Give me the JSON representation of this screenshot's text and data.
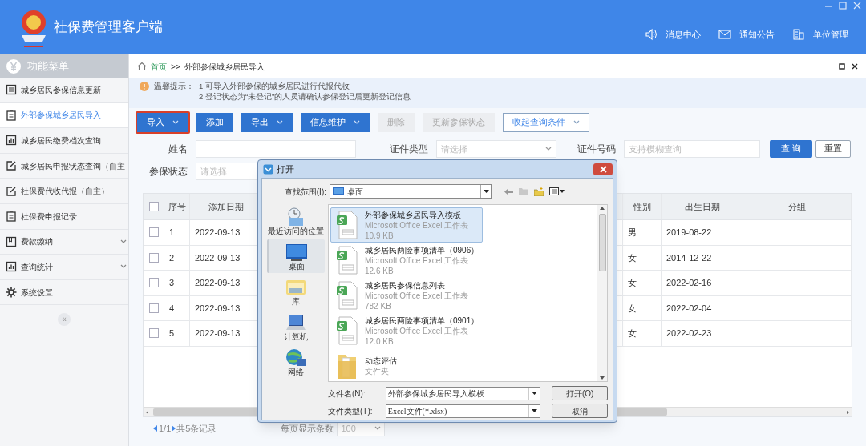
{
  "app": {
    "title": "社保费管理客户端",
    "nav": [
      {
        "label": "消息中心",
        "kind": "speaker"
      },
      {
        "label": "通知公告",
        "kind": "mail"
      },
      {
        "label": "单位管理",
        "kind": "building"
      }
    ]
  },
  "sidebar": {
    "title": "功能菜单",
    "collapse": "«",
    "items": [
      {
        "label": "城乡居民参保信息更新",
        "kind": "list",
        "selected": false,
        "expandable": false
      },
      {
        "label": "外部参保城乡居民导入",
        "kind": "clipboard",
        "selected": true,
        "expandable": false
      },
      {
        "label": "城乡居民缴费档次查询",
        "kind": "chart",
        "selected": false,
        "expandable": false
      },
      {
        "label": "城乡居民申报状态查询（自主",
        "kind": "edit",
        "selected": false,
        "expandable": false
      },
      {
        "label": "社保费代收代报（自主）",
        "kind": "edit",
        "selected": false,
        "expandable": false
      },
      {
        "label": "社保费申报记录",
        "kind": "clipboard",
        "selected": false,
        "expandable": false
      },
      {
        "label": "费款缴纳",
        "kind": "book",
        "selected": false,
        "expandable": true
      },
      {
        "label": "查询统计",
        "kind": "chart",
        "selected": false,
        "expandable": true
      },
      {
        "label": "系统设置",
        "kind": "gear",
        "selected": false,
        "expandable": false
      }
    ]
  },
  "breadcrumb": {
    "home": "首页",
    "separator": ">>",
    "current": "外部参保城乡居民导入"
  },
  "tip": {
    "label": "温馨提示：",
    "lines": [
      "1.可导入外部参保的城乡居民进行代报代收",
      "2.登记状态为“未登记”的人员请确认参保登记后更新登记信息"
    ]
  },
  "toolbar": [
    {
      "label": "导入",
      "kind": "primary",
      "dropdown": true,
      "highlighted": true
    },
    {
      "label": "添加",
      "kind": "primary",
      "dropdown": false,
      "highlighted": false
    },
    {
      "label": "导出",
      "kind": "primary",
      "dropdown": true,
      "highlighted": false
    },
    {
      "label": "信息维护",
      "kind": "primary",
      "dropdown": true,
      "highlighted": false
    },
    {
      "label": "删除",
      "kind": "disabled",
      "dropdown": false,
      "highlighted": false
    },
    {
      "label": "更新参保状态",
      "kind": "disabled",
      "dropdown": false,
      "highlighted": false
    },
    {
      "label": "收起查询条件",
      "kind": "outline",
      "dropdown": true,
      "highlighted": false
    }
  ],
  "filters": [
    {
      "label": "姓名",
      "dropdown": false
    },
    {
      "label": "证件类型",
      "placeholder": "请选择",
      "dropdown": true
    },
    {
      "label": "证件号码",
      "placeholder": "支持模糊查询",
      "dropdown": false
    },
    {
      "label": "参保状态",
      "placeholder": "请选择"
    }
  ],
  "search_buttons": [
    "查 询",
    "重置"
  ],
  "table": {
    "all_checked": false,
    "columns": [
      "序号",
      "添加日期",
      "性别",
      "出生日期",
      "分组"
    ],
    "rows": [
      {
        "checked": false,
        "cells": [
          "1",
          "2022-09-13",
          "男",
          "2019-08-22"
        ]
      },
      {
        "checked": false,
        "cells": [
          "2",
          "2022-09-13",
          "女",
          "2014-12-22"
        ]
      },
      {
        "checked": false,
        "cells": [
          "3",
          "2022-09-13",
          "女",
          "2022-02-16"
        ]
      },
      {
        "checked": false,
        "cells": [
          "4",
          "2022-09-13",
          "女",
          "2022-02-04"
        ]
      },
      {
        "checked": false,
        "cells": [
          "5",
          "2022-09-13",
          "女",
          "2022-02-23"
        ]
      }
    ]
  },
  "pagination": {
    "page": "1/1",
    "total": "共5条记录",
    "size_label": "每页显示条数",
    "size": "100"
  },
  "dialog": {
    "title": "打开",
    "look_in_label": "查找范围(I):",
    "look_in": "桌面",
    "places": [
      {
        "label": "最近访问的位置",
        "kind": "recent",
        "selected": false
      },
      {
        "label": "桌面",
        "kind": "desktop",
        "selected": true
      },
      {
        "label": "库",
        "kind": "library",
        "selected": false
      },
      {
        "label": "计算机",
        "kind": "computer",
        "selected": false
      },
      {
        "label": "网络",
        "kind": "network",
        "selected": false
      }
    ],
    "files": [
      {
        "name": "外部参保城乡居民导入模板",
        "type": "Microsoft Office Excel 工作表",
        "size": "10.9 KB",
        "kind": "excel",
        "selected": true
      },
      {
        "name": "城乡居民两险事项清单（0906）",
        "type": "Microsoft Office Excel 工作表",
        "size": "12.6 KB",
        "kind": "excel",
        "selected": false
      },
      {
        "name": "城乡居民参保信息列表",
        "type": "Microsoft Office Excel 工作表",
        "size": "782 KB",
        "kind": "excel",
        "selected": false
      },
      {
        "name": "城乡居民两险事项清单（0901）",
        "type": "Microsoft Office Excel 工作表",
        "size": "12.0 KB",
        "kind": "excel",
        "selected": false
      },
      {
        "name": "动态评估",
        "type": "文件夹",
        "kind": "folder",
        "selected": false
      }
    ],
    "filename_label": "文件名(N):",
    "filename": "外部参保城乡居民导入模板",
    "filetype_label": "文件类型(T):",
    "filetype": "Excel文件(*.xlsx)",
    "buttons": [
      "打开(O)",
      "取消"
    ]
  }
}
